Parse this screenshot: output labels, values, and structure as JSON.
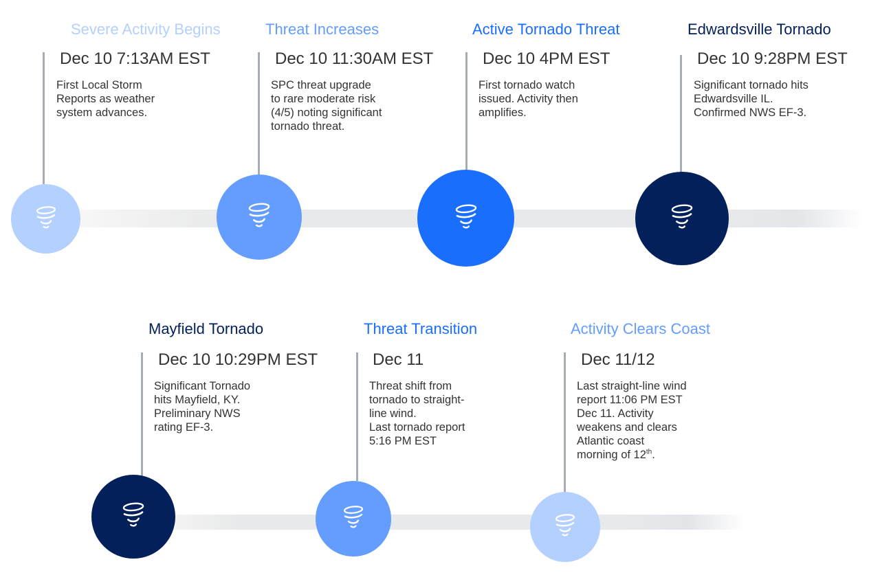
{
  "colors": {
    "pale_blue": "#b3d0fe",
    "light_blue": "#649dfd",
    "bright_blue": "#1a6efe",
    "navy": "#03205a",
    "text_dark": "#333333",
    "connector_gray": "#a7adb5",
    "track_gray": "#e8e9ea"
  },
  "events": [
    {
      "title": "Severe Activity Begins",
      "date": "Dec 10 7:13AM EST",
      "description": "First Local Storm\nReports as weather\nsystem advances.",
      "color": "#b3d0fe",
      "icon": "tornado-icon"
    },
    {
      "title": "Threat Increases",
      "date": "Dec 10 11:30AM EST",
      "description": "SPC threat upgrade\nto rare moderate risk\n(4/5) noting significant\ntornado threat.",
      "color": "#649dfd",
      "icon": "tornado-icon"
    },
    {
      "title": "Active Tornado Threat",
      "date": "Dec 10 4PM EST",
      "description": "First tornado watch\nissued. Activity then\namplifies.",
      "color": "#1a6efe",
      "icon": "tornado-icon"
    },
    {
      "title": "Edwardsville Tornado",
      "date": "Dec 10 9:28PM EST",
      "description": "Significant tornado hits\nEdwardsville IL.\nConfirmed NWS EF-3.",
      "color": "#03205a",
      "icon": "tornado-icon"
    },
    {
      "title": "Mayfield Tornado",
      "date": "Dec 10 10:29PM EST",
      "description": "Significant Tornado\nhits Mayfield, KY.\nPreliminary NWS\nrating EF-3.",
      "color": "#03205a",
      "icon": "tornado-icon"
    },
    {
      "title": "Threat Transition",
      "date": "Dec 11",
      "description": "Threat shift from\ntornado to straight-\nline wind.\nLast tornado report\n5:16 PM EST",
      "color": "#1a6efe",
      "circle_color": "#649dfd",
      "icon": "tornado-icon"
    },
    {
      "title": "Activity Clears Coast",
      "date": "Dec 11/12",
      "description_main": "Last straight-line wind\nreport 11:06 PM EST\nDec 11. Activity\nweakens and clears\nAtlantic coast\nmorning of 12",
      "description_sup": "th",
      "description_end": ".",
      "color": "#649dfd",
      "circle_color": "#b3d0fe",
      "icon": "tornado-icon"
    }
  ]
}
